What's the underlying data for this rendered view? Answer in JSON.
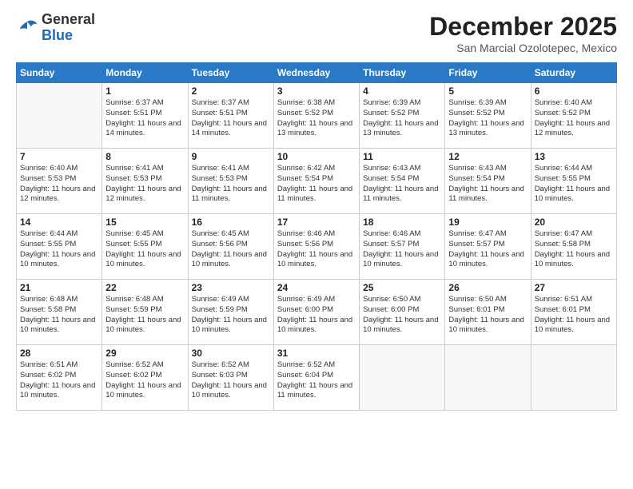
{
  "header": {
    "logo_general": "General",
    "logo_blue": "Blue",
    "month_title": "December 2025",
    "location": "San Marcial Ozolotepec, Mexico"
  },
  "weekdays": [
    "Sunday",
    "Monday",
    "Tuesday",
    "Wednesday",
    "Thursday",
    "Friday",
    "Saturday"
  ],
  "weeks": [
    [
      {
        "day": null
      },
      {
        "day": "1",
        "sunrise": "6:37 AM",
        "sunset": "5:51 PM",
        "daylight": "11 hours and 14 minutes."
      },
      {
        "day": "2",
        "sunrise": "6:37 AM",
        "sunset": "5:51 PM",
        "daylight": "11 hours and 14 minutes."
      },
      {
        "day": "3",
        "sunrise": "6:38 AM",
        "sunset": "5:52 PM",
        "daylight": "11 hours and 13 minutes."
      },
      {
        "day": "4",
        "sunrise": "6:39 AM",
        "sunset": "5:52 PM",
        "daylight": "11 hours and 13 minutes."
      },
      {
        "day": "5",
        "sunrise": "6:39 AM",
        "sunset": "5:52 PM",
        "daylight": "11 hours and 13 minutes."
      },
      {
        "day": "6",
        "sunrise": "6:40 AM",
        "sunset": "5:52 PM",
        "daylight": "11 hours and 12 minutes."
      }
    ],
    [
      {
        "day": "7",
        "sunrise": "6:40 AM",
        "sunset": "5:53 PM",
        "daylight": "11 hours and 12 minutes."
      },
      {
        "day": "8",
        "sunrise": "6:41 AM",
        "sunset": "5:53 PM",
        "daylight": "11 hours and 12 minutes."
      },
      {
        "day": "9",
        "sunrise": "6:41 AM",
        "sunset": "5:53 PM",
        "daylight": "11 hours and 11 minutes."
      },
      {
        "day": "10",
        "sunrise": "6:42 AM",
        "sunset": "5:54 PM",
        "daylight": "11 hours and 11 minutes."
      },
      {
        "day": "11",
        "sunrise": "6:43 AM",
        "sunset": "5:54 PM",
        "daylight": "11 hours and 11 minutes."
      },
      {
        "day": "12",
        "sunrise": "6:43 AM",
        "sunset": "5:54 PM",
        "daylight": "11 hours and 11 minutes."
      },
      {
        "day": "13",
        "sunrise": "6:44 AM",
        "sunset": "5:55 PM",
        "daylight": "11 hours and 10 minutes."
      }
    ],
    [
      {
        "day": "14",
        "sunrise": "6:44 AM",
        "sunset": "5:55 PM",
        "daylight": "11 hours and 10 minutes."
      },
      {
        "day": "15",
        "sunrise": "6:45 AM",
        "sunset": "5:55 PM",
        "daylight": "11 hours and 10 minutes."
      },
      {
        "day": "16",
        "sunrise": "6:45 AM",
        "sunset": "5:56 PM",
        "daylight": "11 hours and 10 minutes."
      },
      {
        "day": "17",
        "sunrise": "6:46 AM",
        "sunset": "5:56 PM",
        "daylight": "11 hours and 10 minutes."
      },
      {
        "day": "18",
        "sunrise": "6:46 AM",
        "sunset": "5:57 PM",
        "daylight": "11 hours and 10 minutes."
      },
      {
        "day": "19",
        "sunrise": "6:47 AM",
        "sunset": "5:57 PM",
        "daylight": "11 hours and 10 minutes."
      },
      {
        "day": "20",
        "sunrise": "6:47 AM",
        "sunset": "5:58 PM",
        "daylight": "11 hours and 10 minutes."
      }
    ],
    [
      {
        "day": "21",
        "sunrise": "6:48 AM",
        "sunset": "5:58 PM",
        "daylight": "11 hours and 10 minutes."
      },
      {
        "day": "22",
        "sunrise": "6:48 AM",
        "sunset": "5:59 PM",
        "daylight": "11 hours and 10 minutes."
      },
      {
        "day": "23",
        "sunrise": "6:49 AM",
        "sunset": "5:59 PM",
        "daylight": "11 hours and 10 minutes."
      },
      {
        "day": "24",
        "sunrise": "6:49 AM",
        "sunset": "6:00 PM",
        "daylight": "11 hours and 10 minutes."
      },
      {
        "day": "25",
        "sunrise": "6:50 AM",
        "sunset": "6:00 PM",
        "daylight": "11 hours and 10 minutes."
      },
      {
        "day": "26",
        "sunrise": "6:50 AM",
        "sunset": "6:01 PM",
        "daylight": "11 hours and 10 minutes."
      },
      {
        "day": "27",
        "sunrise": "6:51 AM",
        "sunset": "6:01 PM",
        "daylight": "11 hours and 10 minutes."
      }
    ],
    [
      {
        "day": "28",
        "sunrise": "6:51 AM",
        "sunset": "6:02 PM",
        "daylight": "11 hours and 10 minutes."
      },
      {
        "day": "29",
        "sunrise": "6:52 AM",
        "sunset": "6:02 PM",
        "daylight": "11 hours and 10 minutes."
      },
      {
        "day": "30",
        "sunrise": "6:52 AM",
        "sunset": "6:03 PM",
        "daylight": "11 hours and 10 minutes."
      },
      {
        "day": "31",
        "sunrise": "6:52 AM",
        "sunset": "6:04 PM",
        "daylight": "11 hours and 11 minutes."
      },
      {
        "day": null
      },
      {
        "day": null
      },
      {
        "day": null
      }
    ]
  ]
}
